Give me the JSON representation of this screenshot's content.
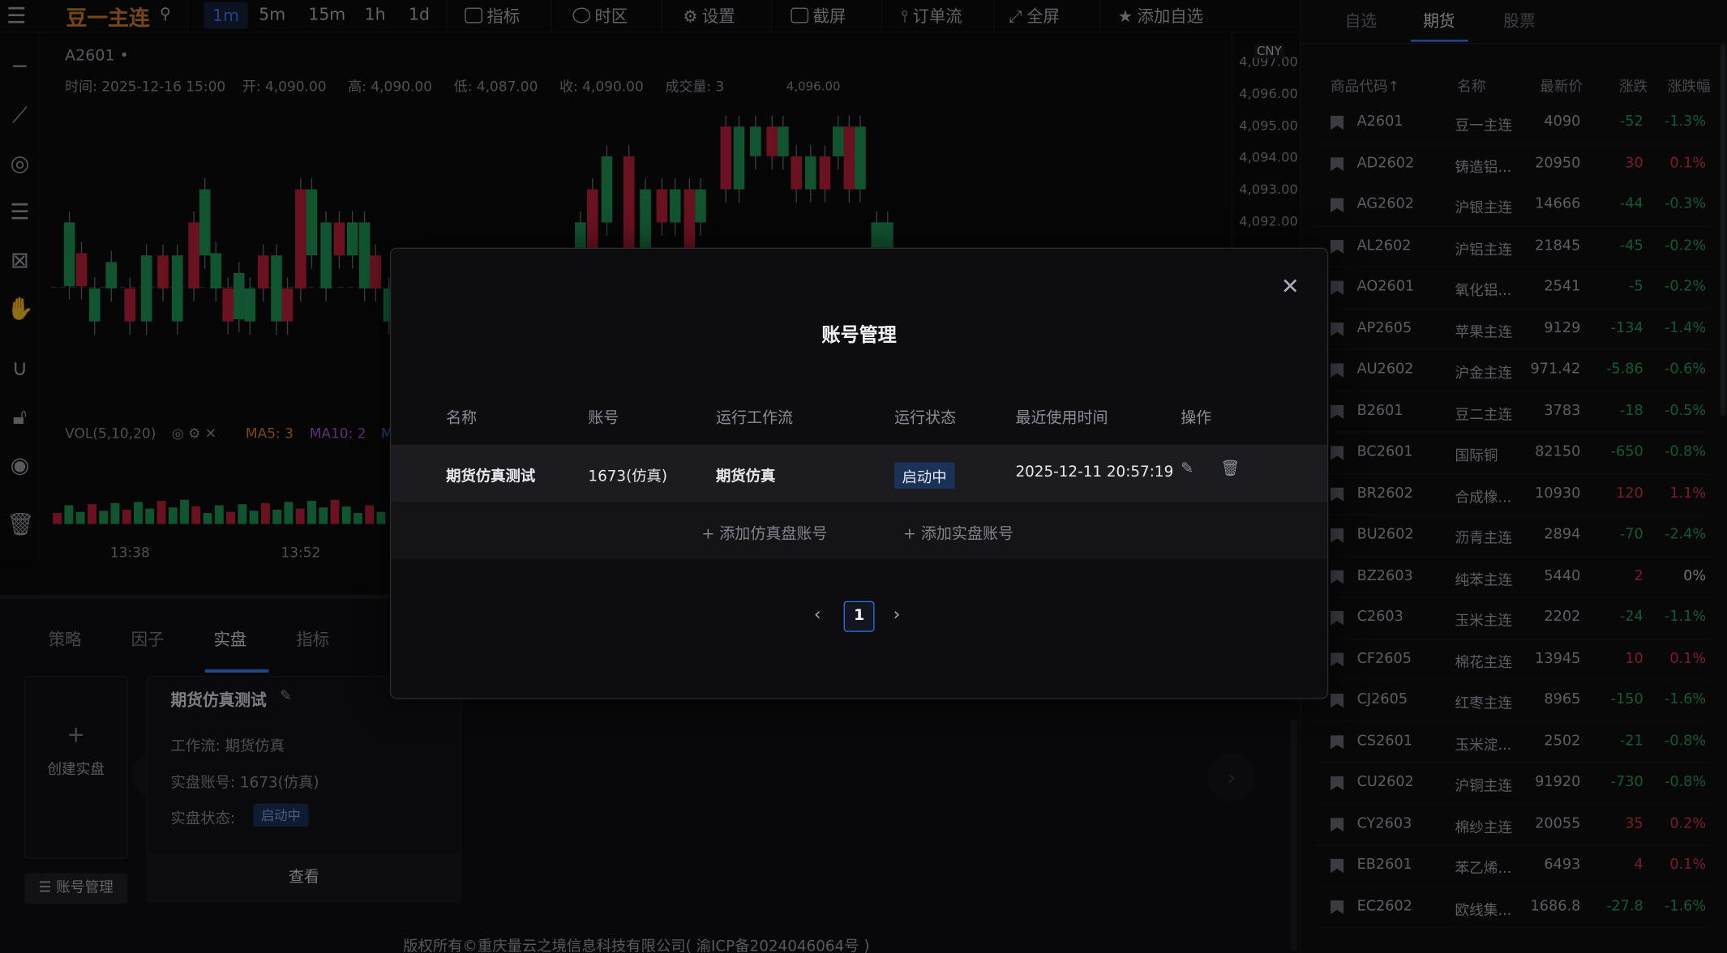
{
  "topbar": {
    "symbol": "豆一主连",
    "intervals": [
      "1m",
      "5m",
      "15m",
      "1h",
      "1d"
    ],
    "menu": [
      "指标",
      "时区",
      "设置",
      "截屏",
      "订单流",
      "全屏",
      "添加自选"
    ]
  },
  "chart": {
    "code": "A2601",
    "ohlc": {
      "time": "时间: 2025-12-16 15:00",
      "open": "开: 4,090.00",
      "high": "高: 4,090.00",
      "low": "低: 4,087.00",
      "close": "收: 4,090.00",
      "vol": "成交量: 3"
    },
    "peak_label": "4,096.00",
    "currency": "CNY",
    "y_ticks": [
      "4,097.00",
      "4,096.00",
      "4,095.00",
      "4,094.00",
      "4,093.00",
      "4,092.00"
    ],
    "vol": {
      "label": "VOL(5,10,20)",
      "ma5": "MA5: 3",
      "ma10": "MA10: 2",
      "ma20": "M"
    },
    "time_ticks": [
      "13:38",
      "13:52"
    ]
  },
  "bottom": {
    "tabs": [
      "策略",
      "因子",
      "实盘",
      "指标"
    ],
    "create_label": "创建实盘",
    "account_btn": "账号管理",
    "card": {
      "title": "期货仿真测试",
      "workflow": "工作流: 期货仿真",
      "account": "实盘账号: 1673(仿真)",
      "status_label": "实盘状态:",
      "status": "启动中",
      "view": "查看"
    },
    "footer": "版权所有©重庆量云之境信息科技有限公司( 渝ICP备2024046064号 )"
  },
  "right": {
    "tabs": [
      "自选",
      "期货",
      "股票"
    ],
    "headers": [
      "商品代码↑",
      "名称",
      "最新价",
      "涨跌",
      "涨跌幅"
    ],
    "rows": [
      {
        "code": "A2601",
        "name": "豆一主连",
        "price": "4090",
        "chg": "-52",
        "pct": "-1.3%"
      },
      {
        "code": "AD2602",
        "name": "铸造铝...",
        "price": "20950",
        "chg": "30",
        "pct": "0.1%"
      },
      {
        "code": "AG2602",
        "name": "沪银主连",
        "price": "14666",
        "chg": "-44",
        "pct": "-0.3%"
      },
      {
        "code": "AL2602",
        "name": "沪铝主连",
        "price": "21845",
        "chg": "-45",
        "pct": "-0.2%"
      },
      {
        "code": "AO2601",
        "name": "氧化铝...",
        "price": "2541",
        "chg": "-5",
        "pct": "-0.2%"
      },
      {
        "code": "AP2605",
        "name": "苹果主连",
        "price": "9129",
        "chg": "-134",
        "pct": "-1.4%"
      },
      {
        "code": "AU2602",
        "name": "沪金主连",
        "price": "971.42",
        "chg": "-5.86",
        "pct": "-0.6%"
      },
      {
        "code": "B2601",
        "name": "豆二主连",
        "price": "3783",
        "chg": "-18",
        "pct": "-0.5%"
      },
      {
        "code": "BC2601",
        "name": "国际铜",
        "price": "82150",
        "chg": "-650",
        "pct": "-0.8%"
      },
      {
        "code": "BR2602",
        "name": "合成橡...",
        "price": "10930",
        "chg": "120",
        "pct": "1.1%"
      },
      {
        "code": "BU2602",
        "name": "沥青主连",
        "price": "2894",
        "chg": "-70",
        "pct": "-2.4%"
      },
      {
        "code": "BZ2603",
        "name": "纯苯主连",
        "price": "5440",
        "chg": "2",
        "pct": "0%"
      },
      {
        "code": "C2603",
        "name": "玉米主连",
        "price": "2202",
        "chg": "-24",
        "pct": "-1.1%"
      },
      {
        "code": "CF2605",
        "name": "棉花主连",
        "price": "13945",
        "chg": "10",
        "pct": "0.1%"
      },
      {
        "code": "CJ2605",
        "name": "红枣主连",
        "price": "8965",
        "chg": "-150",
        "pct": "-1.6%"
      },
      {
        "code": "CS2601",
        "name": "玉米淀...",
        "price": "2502",
        "chg": "-21",
        "pct": "-0.8%"
      },
      {
        "code": "CU2602",
        "name": "沪铜主连",
        "price": "91920",
        "chg": "-730",
        "pct": "-0.8%"
      },
      {
        "code": "CY2603",
        "name": "棉纱主连",
        "price": "20055",
        "chg": "35",
        "pct": "0.2%"
      },
      {
        "code": "EB2601",
        "name": "苯乙烯...",
        "price": "6493",
        "chg": "4",
        "pct": "0.1%"
      },
      {
        "code": "EC2602",
        "name": "欧线集...",
        "price": "1686.8",
        "chg": "-27.8",
        "pct": "-1.6%"
      }
    ]
  },
  "modal": {
    "title": "账号管理",
    "headers": [
      "名称",
      "账号",
      "运行工作流",
      "运行状态",
      "最近使用时间",
      "操作"
    ],
    "row": {
      "name": "期货仿真测试",
      "account": "1673(仿真)",
      "workflow": "期货仿真",
      "status": "启动中",
      "time": "2025-12-11 20:57:19"
    },
    "add_sim": "+ 添加仿真盘账号",
    "add_real": "+ 添加实盘账号",
    "page": "1"
  },
  "colors": {
    "up": "#e0324a",
    "down": "#26a05a",
    "accent": "#3d7df0"
  }
}
